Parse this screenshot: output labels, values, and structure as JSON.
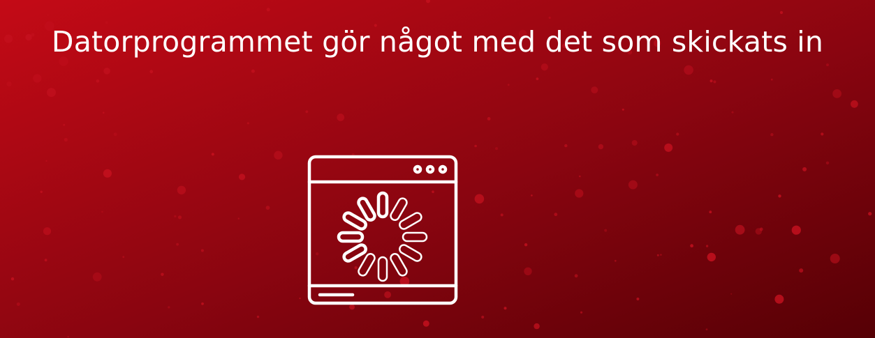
{
  "slide": {
    "title": "Datorprogrammet gör något med det som skickats in"
  },
  "icon": {
    "name": "loading-window-icon"
  },
  "colors": {
    "background_start": "#c40a16",
    "background_end": "#560005",
    "speckle": "#c5111f",
    "foreground": "#ffffff"
  }
}
